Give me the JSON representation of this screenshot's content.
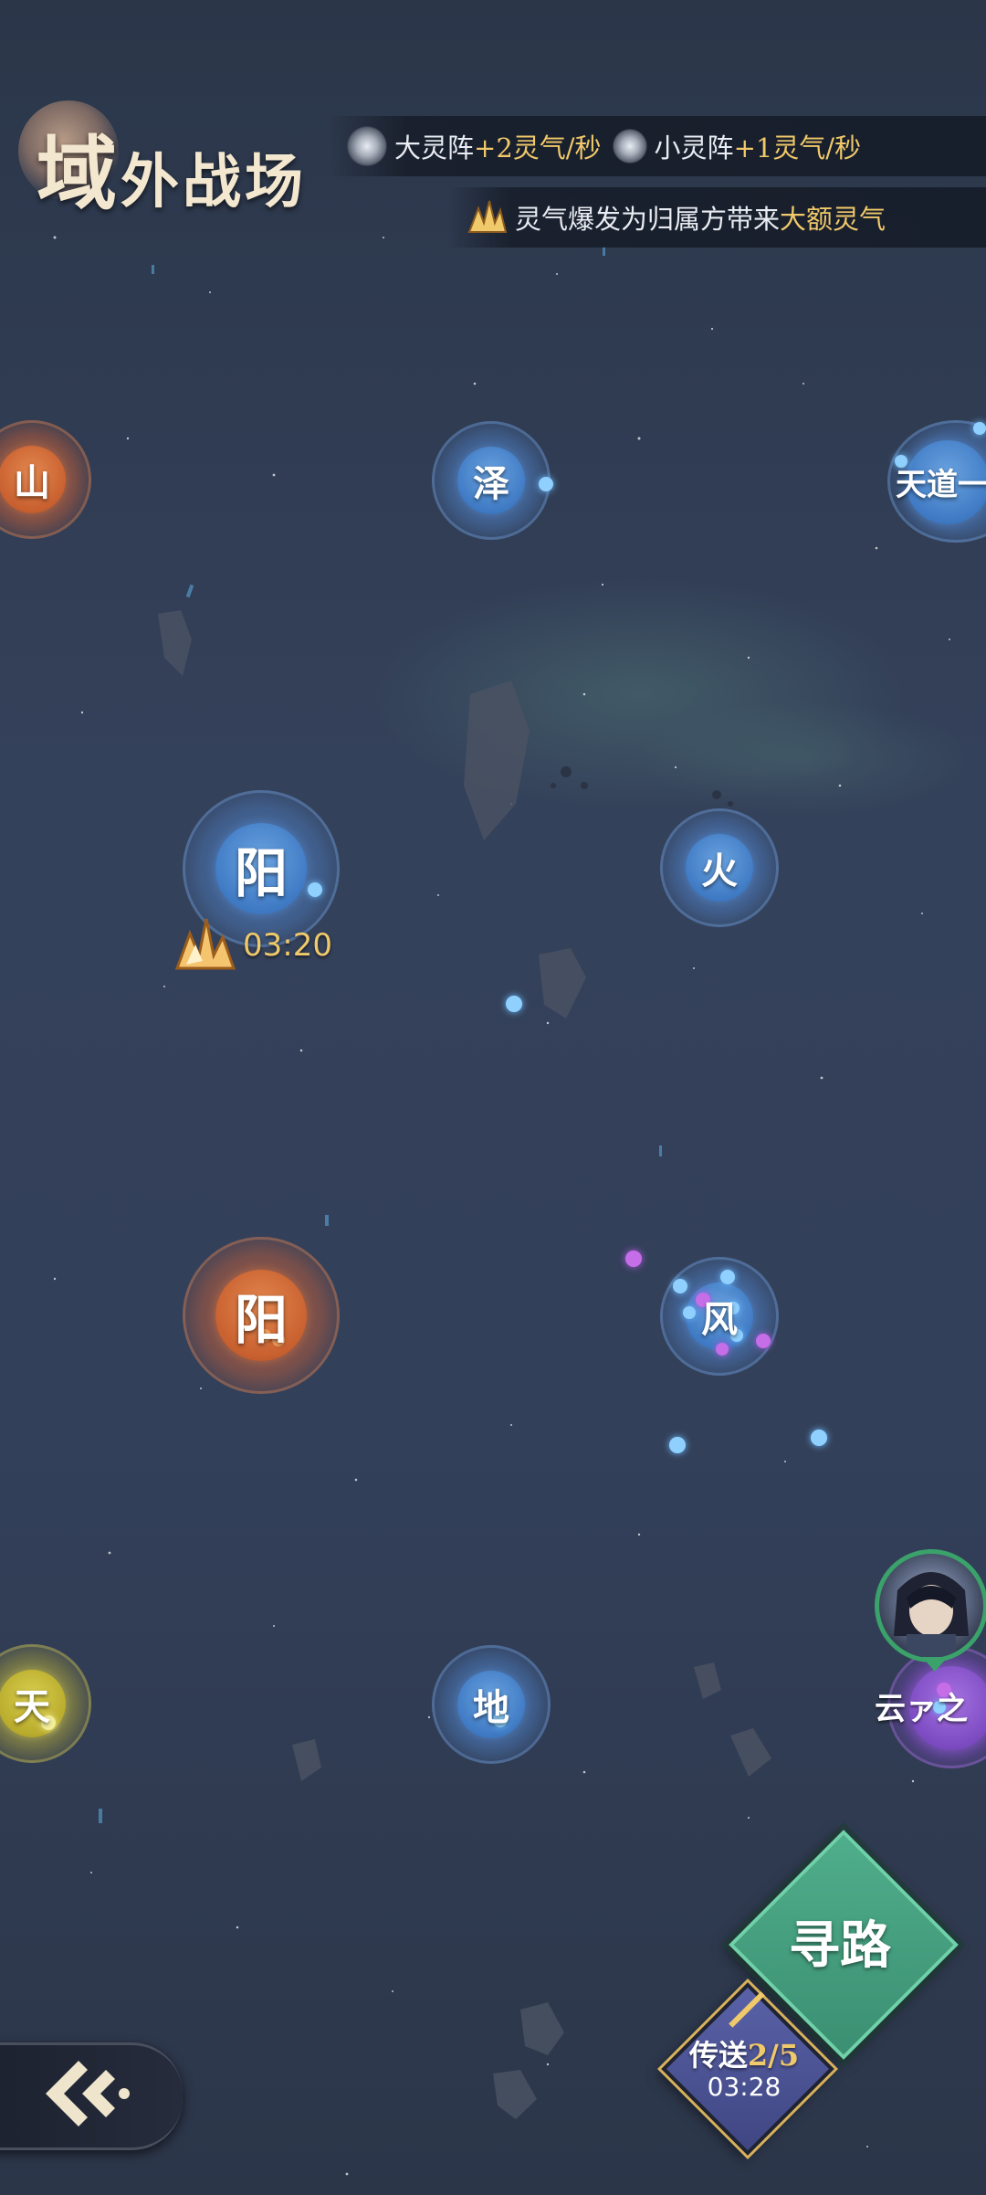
{
  "header": {
    "title_char1": "域",
    "title_rest": "外战场",
    "info_row1": {
      "big_array_label": "大灵阵",
      "big_array_value": "+2灵气/秒",
      "small_array_label": "小灵阵",
      "small_array_value": "+1灵气/秒"
    },
    "info_row2": {
      "text": "灵气爆发为归属方带来",
      "highlight": "大额灵气"
    }
  },
  "map": {
    "nodes": [
      {
        "label": "山",
        "color": "orange"
      },
      {
        "label": "泽",
        "color": "blue"
      },
      {
        "label": "天道一",
        "color": "blue"
      },
      {
        "label": "阳",
        "color": "blue"
      },
      {
        "label": "火",
        "color": "blue"
      },
      {
        "label": "阳",
        "color": "orange"
      },
      {
        "label": "风",
        "color": "blue"
      },
      {
        "label": "天",
        "color": "yellow"
      },
      {
        "label": "地",
        "color": "blue"
      }
    ],
    "burst_timer": "03:20",
    "player_name": "云ァ之"
  },
  "controls": {
    "pathfind_label": "寻路",
    "teleport_label": "传送",
    "teleport_count": "2/5",
    "teleport_timer": "03:28"
  },
  "colors": {
    "blue_node": "#3f7ac4",
    "orange_node": "#c8602f",
    "yellow_node": "#b9ab2c",
    "purple_node": "#7c4bc2",
    "gold_text": "#f0c96a",
    "pathfind_green": "#4fae8c",
    "teleport_indigo": "#5a62a8"
  }
}
